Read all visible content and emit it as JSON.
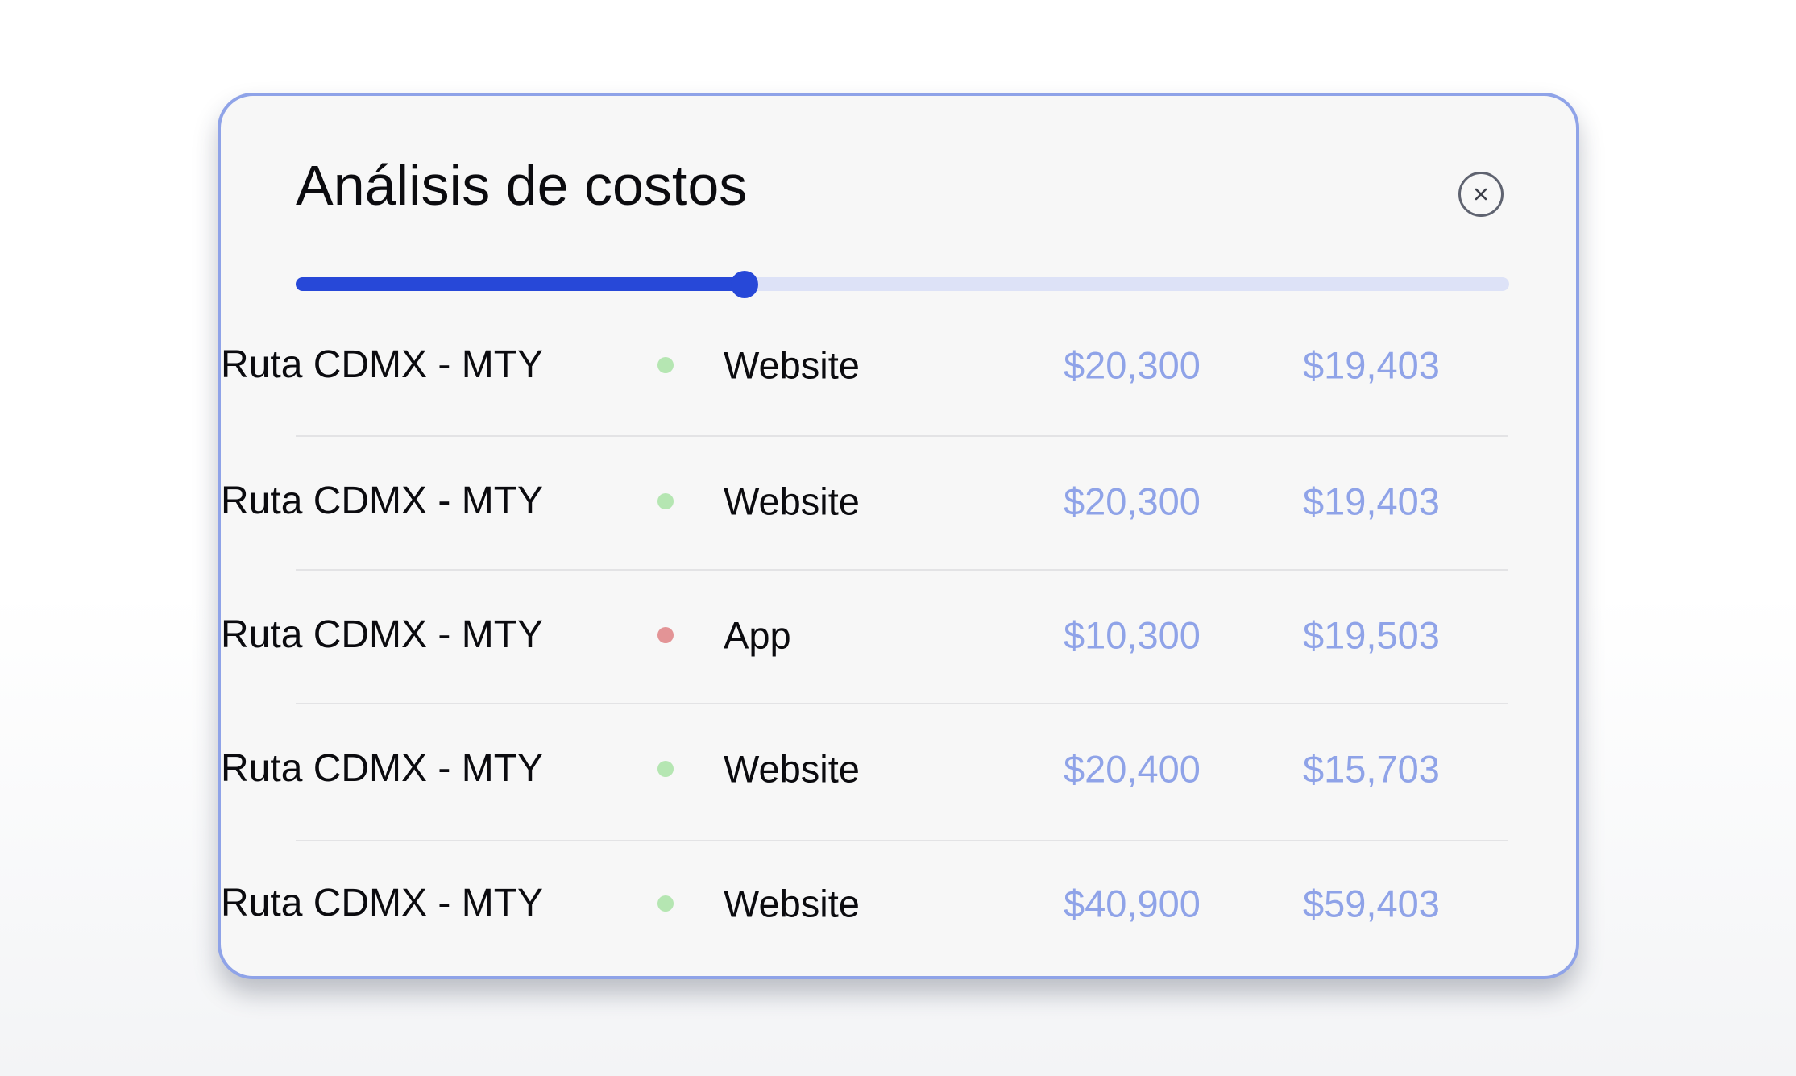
{
  "panel": {
    "title": "Análisis de costos",
    "close_icon": "close-icon",
    "slider": {
      "value_percent": 37
    }
  },
  "colors": {
    "accent": "#2748d8",
    "track": "#dde2f7",
    "amount": "#8fa3e8",
    "status_green": "#b5e6b2",
    "status_red": "#e39496",
    "border": "#8fa3e8"
  },
  "rows": [
    {
      "route": "Ruta CDMX - MTY",
      "status": "green",
      "channel": "Website",
      "amount1": "$20,300",
      "amount2": "$19,403"
    },
    {
      "route": "Ruta CDMX - MTY",
      "status": "green",
      "channel": "Website",
      "amount1": "$20,300",
      "amount2": "$19,403"
    },
    {
      "route": "Ruta CDMX - MTY",
      "status": "red",
      "channel": "App",
      "amount1": "$10,300",
      "amount2": "$19,503"
    },
    {
      "route": "Ruta CDMX - MTY",
      "status": "green",
      "channel": "Website",
      "amount1": "$20,400",
      "amount2": "$15,703"
    },
    {
      "route": "Ruta CDMX - MTY",
      "status": "green",
      "channel": "Website",
      "amount1": "$40,900",
      "amount2": "$59,403"
    }
  ]
}
